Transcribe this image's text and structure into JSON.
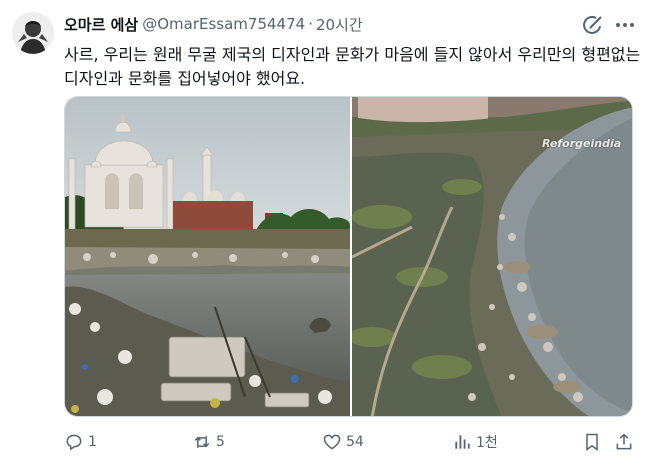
{
  "post": {
    "display_name": "오마르 에삼",
    "handle": "@OmarEssam754474",
    "separator": "·",
    "time": "20시간",
    "text": "사르, 우리는 원래 무굴 제국의 디자인과 문화가 마음에 들지 않아서 우리만의 형편없는 디자인과 문화를 집어넣어야 했어요."
  },
  "media": {
    "watermark": "Reforgeindia"
  },
  "actions": {
    "replies": "1",
    "reposts": "5",
    "likes": "54",
    "views": "1천"
  },
  "icons": [
    "avatar",
    "grok-icon",
    "more-icon",
    "reply-icon",
    "repost-icon",
    "like-icon",
    "views-icon",
    "bookmark-icon",
    "share-icon"
  ],
  "colors": {
    "text": "#0f1419",
    "secondary": "#536471",
    "border": "#cfd9de"
  }
}
